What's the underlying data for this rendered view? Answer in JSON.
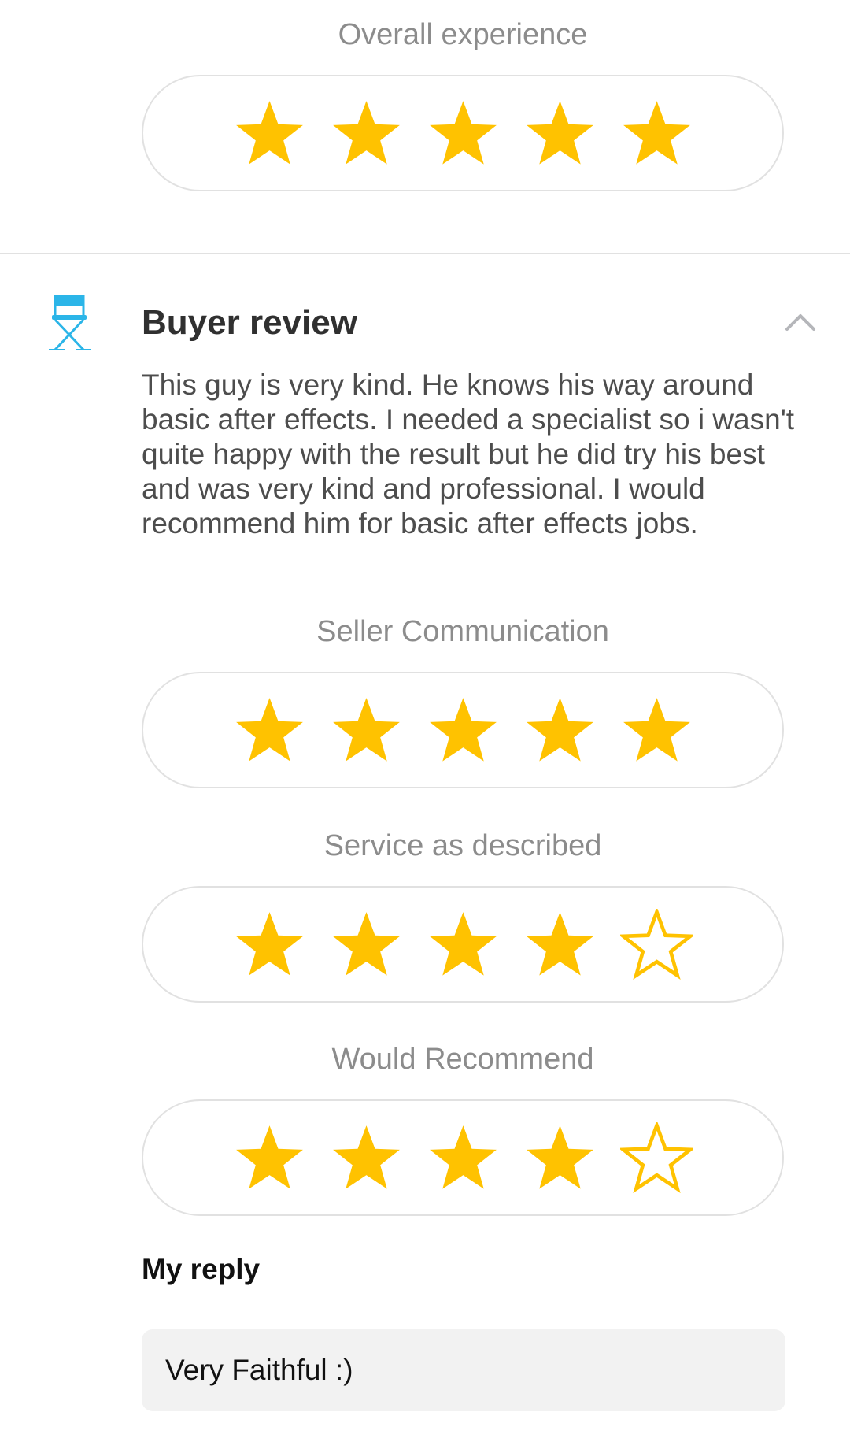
{
  "colors": {
    "star_filled": "#ffc200",
    "star_outline": "#ffc200",
    "icon_blue": "#1dbf73"
  },
  "ratings": [
    {
      "label": "Overall experience",
      "stars": 5,
      "max": 5
    },
    {
      "label": "Seller Communication",
      "stars": 5,
      "max": 5
    },
    {
      "label": "Service as described",
      "stars": 4,
      "max": 5
    },
    {
      "label": "Would Recommend",
      "stars": 4,
      "max": 5
    }
  ],
  "buyer_review": {
    "icon": "director-chair-icon",
    "title": "Buyer review",
    "collapse_icon": "chevron-up-icon",
    "text": "This guy is very kind. He knows his way around basic after effects. I needed a specialist so i wasn't quite happy with the result but he did try his best and was very kind and professional. I would recommend him for basic after effects jobs."
  },
  "reply": {
    "title": "My reply",
    "text": "Very Faithful :)"
  }
}
